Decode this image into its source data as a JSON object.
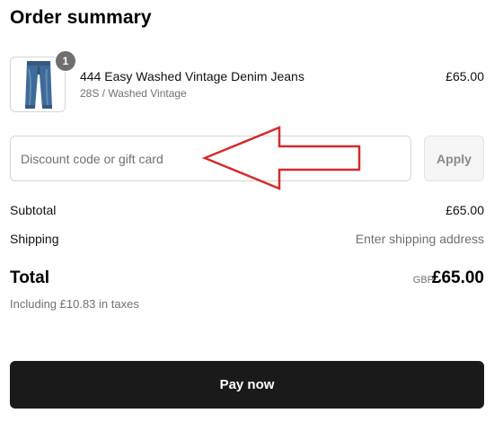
{
  "order_summary": {
    "title": "Order summary"
  },
  "product": {
    "name": "444 Easy Washed Vintage Denim Jeans",
    "variant": "28S / Washed Vintage",
    "price": "£65.00",
    "quantity": "1",
    "image_icon": "denim-jeans-icon"
  },
  "discount": {
    "placeholder": "Discount code or gift card",
    "value": "",
    "apply_label": "Apply"
  },
  "annotation": {
    "icon": "left-arrow-icon",
    "color": "#d62b2b"
  },
  "totals": {
    "subtotal_label": "Subtotal",
    "subtotal_value": "£65.00",
    "shipping_label": "Shipping",
    "shipping_value": "Enter shipping address",
    "total_label": "Total",
    "total_currency": "GBP",
    "total_value": "£65.00",
    "taxes_note": "Including £10.83 in taxes"
  },
  "pay": {
    "label": "Pay now"
  },
  "colors": {
    "pay_button": "#1a1a1a",
    "muted_text": "#707070",
    "border": "#d6d6d6"
  }
}
